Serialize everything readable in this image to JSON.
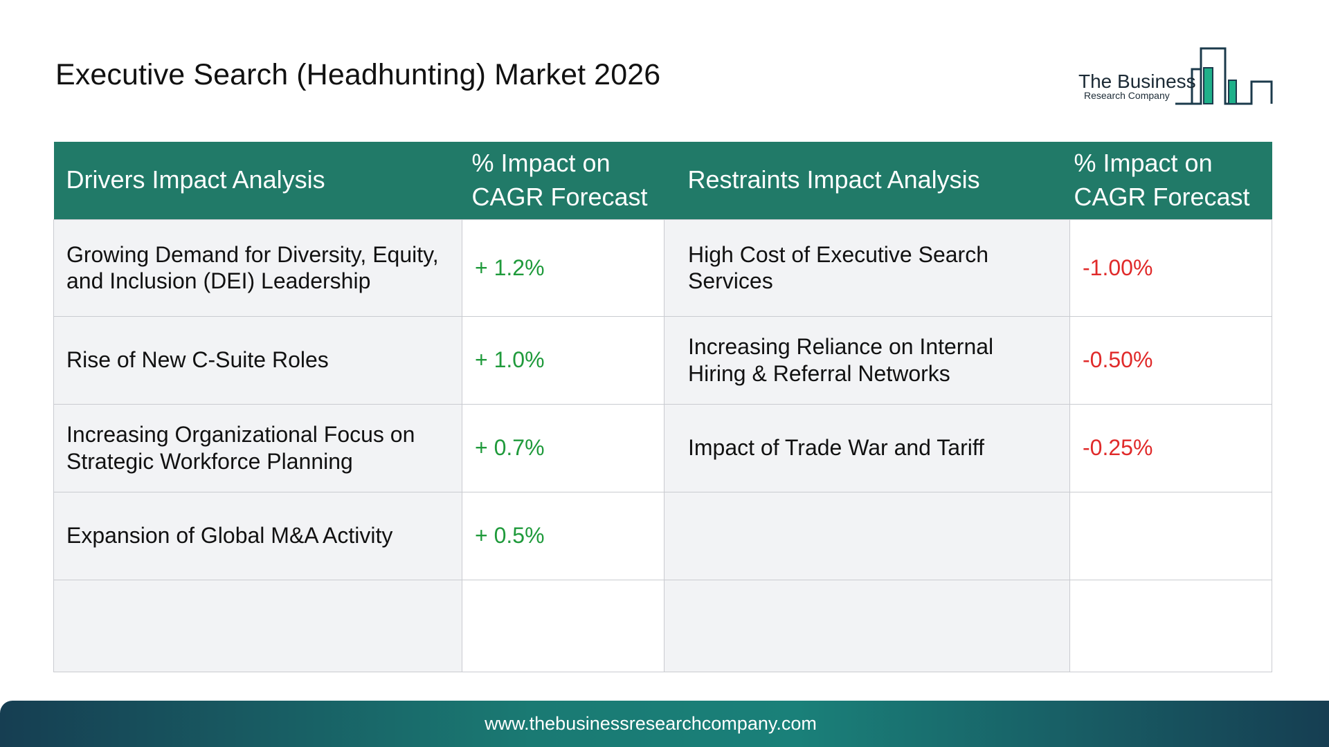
{
  "page": {
    "title": "Executive Search (Headhunting) Market 2026"
  },
  "logo": {
    "line1": "The Business",
    "line2": "Research Company"
  },
  "table": {
    "headers": {
      "drivers": "Drivers Impact Analysis",
      "drivers_impact": "% Impact on CAGR Forecast",
      "restraints": "Restraints Impact Analysis",
      "restraints_impact": "% Impact on CAGR Forecast"
    },
    "rows": [
      {
        "driver": "Growing Demand for Diversity, Equity, and Inclusion (DEI) Leadership",
        "driver_impact": "+ 1.2%",
        "restraint": "High Cost of Executive Search Services",
        "restraint_impact": "-1.00%"
      },
      {
        "driver": "Rise of New C-Suite Roles",
        "driver_impact": "+ 1.0%",
        "restraint": "Increasing Reliance on Internal Hiring & Referral Networks",
        "restraint_impact": "-0.50%"
      },
      {
        "driver": "Increasing Organizational Focus on Strategic Workforce Planning",
        "driver_impact": "+ 0.7%",
        "restraint": "Impact of Trade War and Tariff",
        "restraint_impact": "-0.25%"
      },
      {
        "driver": "Expansion of Global M&A Activity",
        "driver_impact": "+ 0.5%",
        "restraint": "",
        "restraint_impact": ""
      },
      {
        "driver": "",
        "driver_impact": "",
        "restraint": "",
        "restraint_impact": ""
      }
    ]
  },
  "footer": {
    "url": "www.thebusinessresearchcompany.com"
  },
  "colors": {
    "header_bg": "#217a68",
    "positive": "#1f9a3b",
    "negative": "#e02a2a",
    "label_bg": "#f2f3f5",
    "footer_dark": "#163e52",
    "footer_teal": "#1a8079"
  }
}
